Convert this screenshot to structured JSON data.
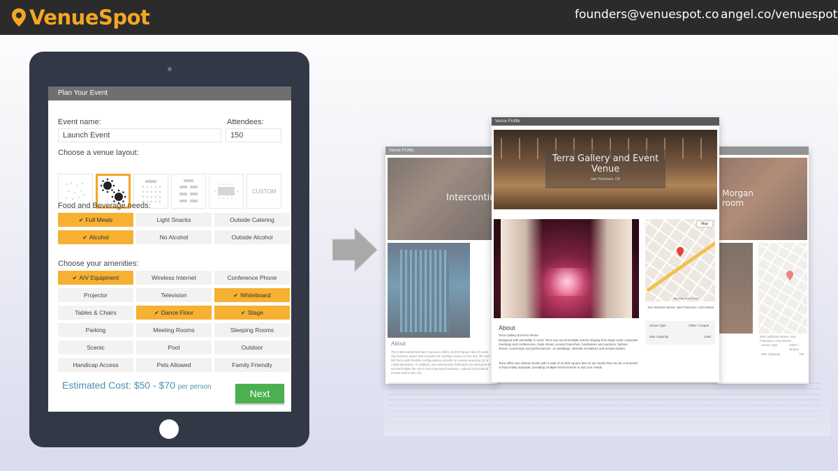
{
  "header": {
    "logo_text": "VenueSpot",
    "email": "founders@venuespot.co",
    "angel": "angel.co/venuespot"
  },
  "planner": {
    "title": "Plan Your Event",
    "event_name_label": "Event name:",
    "event_name_value": "Launch Event",
    "attendees_label": "Attendees:",
    "attendees_value": "150",
    "layout_label": "Choose a venue layout:",
    "layout_custom": "CUSTOM",
    "food_label": "Food and Beverage needs:",
    "food_options": [
      {
        "label": "Full Meals",
        "selected": true
      },
      {
        "label": "Light Snacks",
        "selected": false
      },
      {
        "label": "Outside Catering",
        "selected": false
      },
      {
        "label": "Alcohol",
        "selected": true
      },
      {
        "label": "No Alcohol",
        "selected": false
      },
      {
        "label": "Outside Alcohol",
        "selected": false
      }
    ],
    "amenities_label": "Choose your amenities:",
    "amenities": [
      {
        "label": "A/V Equipment",
        "selected": true
      },
      {
        "label": "Wireless Internet",
        "selected": false
      },
      {
        "label": "Conference Phone",
        "selected": false
      },
      {
        "label": "Projector",
        "selected": false
      },
      {
        "label": "Television",
        "selected": false
      },
      {
        "label": "Whiteboard",
        "selected": true
      },
      {
        "label": "Tables & Chairs",
        "selected": false
      },
      {
        "label": "Dance Floor",
        "selected": true
      },
      {
        "label": "Stage",
        "selected": true
      },
      {
        "label": "Parking",
        "selected": false
      },
      {
        "label": "Meeting Rooms",
        "selected": false
      },
      {
        "label": "Sleeping Rooms",
        "selected": false
      },
      {
        "label": "Scenic",
        "selected": false
      },
      {
        "label": "Pool",
        "selected": false
      },
      {
        "label": "Outdoor",
        "selected": false
      },
      {
        "label": "Handicap Access",
        "selected": false
      },
      {
        "label": "Pets Allowed",
        "selected": false
      },
      {
        "label": "Family Friendly",
        "selected": false
      }
    ],
    "cost_prefix": "Estimated Cost: $50 - $70",
    "cost_suffix": "per person",
    "next_label": "Next"
  },
  "venues": {
    "bar_label": "Venue Profile",
    "center_title": "Terra Gallery and Event Venue",
    "center_subtitle": "San Francisco, CA",
    "left_title": "Intercontin",
    "right_title": "Morgan room",
    "about_label": "About",
    "center_about_heading": "Terra Gallery & Event Venue",
    "center_about_body": "Designed with versatility in mind, Terra can accommodate events ranging from large scale corporate meetings and conferences, trade shows, product launches, fundraisers and auctions, fashion shows, screenings and performances...to weddings, intimate receptions and private parties.",
    "center_about_body2": "Terra offers two diverse levels with a total of 24,000 square feet on two levels that can be connected or kept totally separate, providing multiple environments to suit your needs.",
    "left_about_body": "The InterContinental San Francisco offers 43,000 square feet of event and function space that includes 21 meeting rooms on the 3rd, 4th and 5th floors with flexible configurations provide for events requiring 30 to 1,600 attendees. In addition, two spectacular ballrooms are designed to accommodate the city's most important business, cultural and political events held in the city.",
    "center_address": "511 Harrison Street, San Francisco, USA 94110",
    "right_address": "405 California Street, San Francisco, USA 94104",
    "venue_type_label": "Venue Type",
    "venue_type_value": "Other / Unique",
    "max_capacity_label": "Max Capacity",
    "center_capacity": "1450",
    "right_capacity": "750",
    "map_button": "Map",
    "map_footer": "Map Data   Terms of Use"
  },
  "colors": {
    "brand_orange": "#f5a623",
    "selected_option": "#f6b032",
    "next_green": "#4caf50",
    "cost_blue": "#4a8fb0",
    "topbar": "#2b2b2b",
    "tablet": "#323846"
  }
}
